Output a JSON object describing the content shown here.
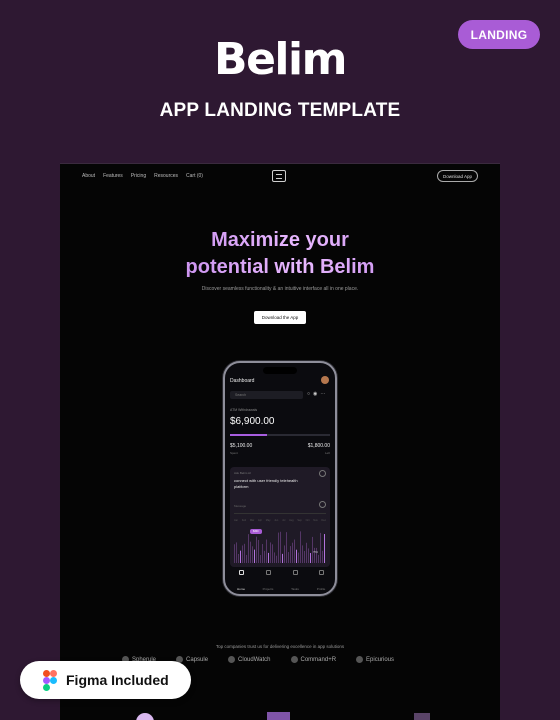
{
  "badge": "LANDING",
  "brand": "Belim",
  "subtitle": "APP LANDING TEMPLATE",
  "preview": {
    "nav": {
      "links": [
        "About",
        "Features",
        "Pricing",
        "Resources",
        "Cart (0)"
      ],
      "cta": "Download App"
    },
    "hero": {
      "title_line1": "Maximize your",
      "title_line2": "potential with Belim",
      "description": "Discover seamless functionality & an intuitive interface all in one place.",
      "button": "Download the App"
    },
    "phone": {
      "title": "Dashboard",
      "search_placeholder": "Search",
      "balance_label": "ATM Withdrawals",
      "balance": "$6,900.00",
      "balance_progress": 0.37,
      "spent_value": "$5,100.00",
      "spent_label": "Spent",
      "left_value": "$1,800.00",
      "left_label": "Left",
      "card": {
        "prompt_label": "Ask Belim AI",
        "prompt_text": "connect with user friendly telehealth platform",
        "input_placeholder": "Message"
      },
      "months": [
        "Jan",
        "Feb",
        "Mar",
        "Apr",
        "May",
        "Jun",
        "Jul",
        "Aug",
        "Sep",
        "Oct",
        "Nov",
        "Dec"
      ],
      "tag1": "$300",
      "tag2": "75%",
      "tabs": [
        "Home",
        "Projects",
        "Tasks",
        "Profile"
      ]
    },
    "trusted_text": "Top companies trust us for delivering excellence in app solutions",
    "logos": [
      "Spherule",
      "Capsule",
      "CloudWatch",
      "Command+R",
      "Epicurious"
    ]
  },
  "figma": {
    "label": "Figma Included"
  },
  "colors": {
    "page_bg": "#2e1832",
    "accent": "#a95cd6",
    "preview_bg": "#050505"
  }
}
